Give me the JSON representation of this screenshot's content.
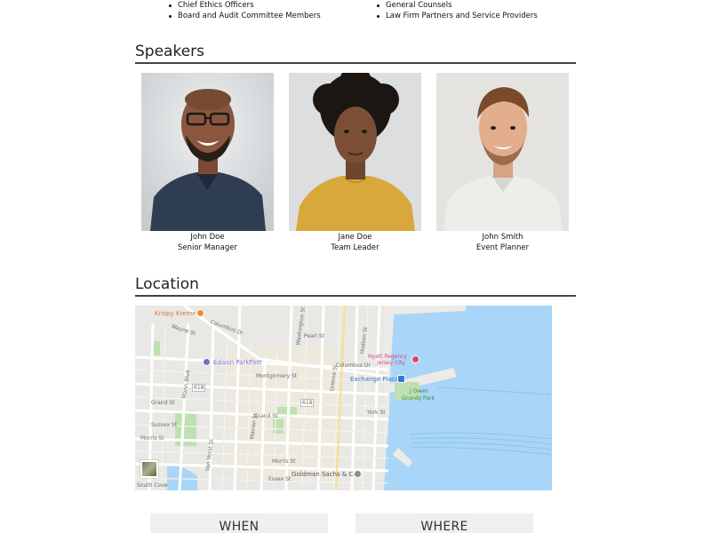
{
  "audience": {
    "left_items": [
      "Chief Ethics Officers",
      "Board and Audit Committee Members"
    ],
    "right_items": [
      "General Counsels",
      "Law Firm Partners and Service Providers"
    ]
  },
  "speakers_section": {
    "title": "Speakers",
    "speakers": [
      {
        "name": "John Doe",
        "role": "Senior Manager"
      },
      {
        "name": "Jane Doe",
        "role": "Team Leader"
      },
      {
        "name": "John Smith",
        "role": "Event Planner"
      }
    ]
  },
  "location_section": {
    "title": "Location",
    "map_labels": {
      "krispy_kreme": "Krispy Kreme",
      "columbus_dr": "Columbus Dr",
      "wayne_st": "Wayne St",
      "pearl_st": "Pearl St",
      "edison_parkfast": "Edison ParkFast",
      "hyatt": "Hyatt Regency",
      "hyatt_2": "Jersey City",
      "exchange_place": "Exchange Place",
      "j_owen": "J Owen",
      "grundy_park": "Grundy Park",
      "montgomery_st": "Montgomery St",
      "grand_st": "Grand St",
      "grand_st_2": "Grand St",
      "york_st": "York St",
      "sussex_st": "Sussex St",
      "morris_st": "Morris St",
      "morris_st_2": "Morris St",
      "essex_st": "Essex St",
      "goldman_sachs": "Goldman Sachs & Co",
      "south_cove": "South Cove",
      "marin_blvd": "Marin Blvd",
      "washington_st": "Washington St",
      "warren_st": "Warren St",
      "greene_st": "Greene St",
      "hudson_st": "Hudson St",
      "van_vorst_st": "Van Vorst St",
      "route_618": "618",
      "route_618_2": "618"
    }
  },
  "when_box": {
    "label": "WHEN"
  },
  "where_box": {
    "label": "WHERE"
  }
}
